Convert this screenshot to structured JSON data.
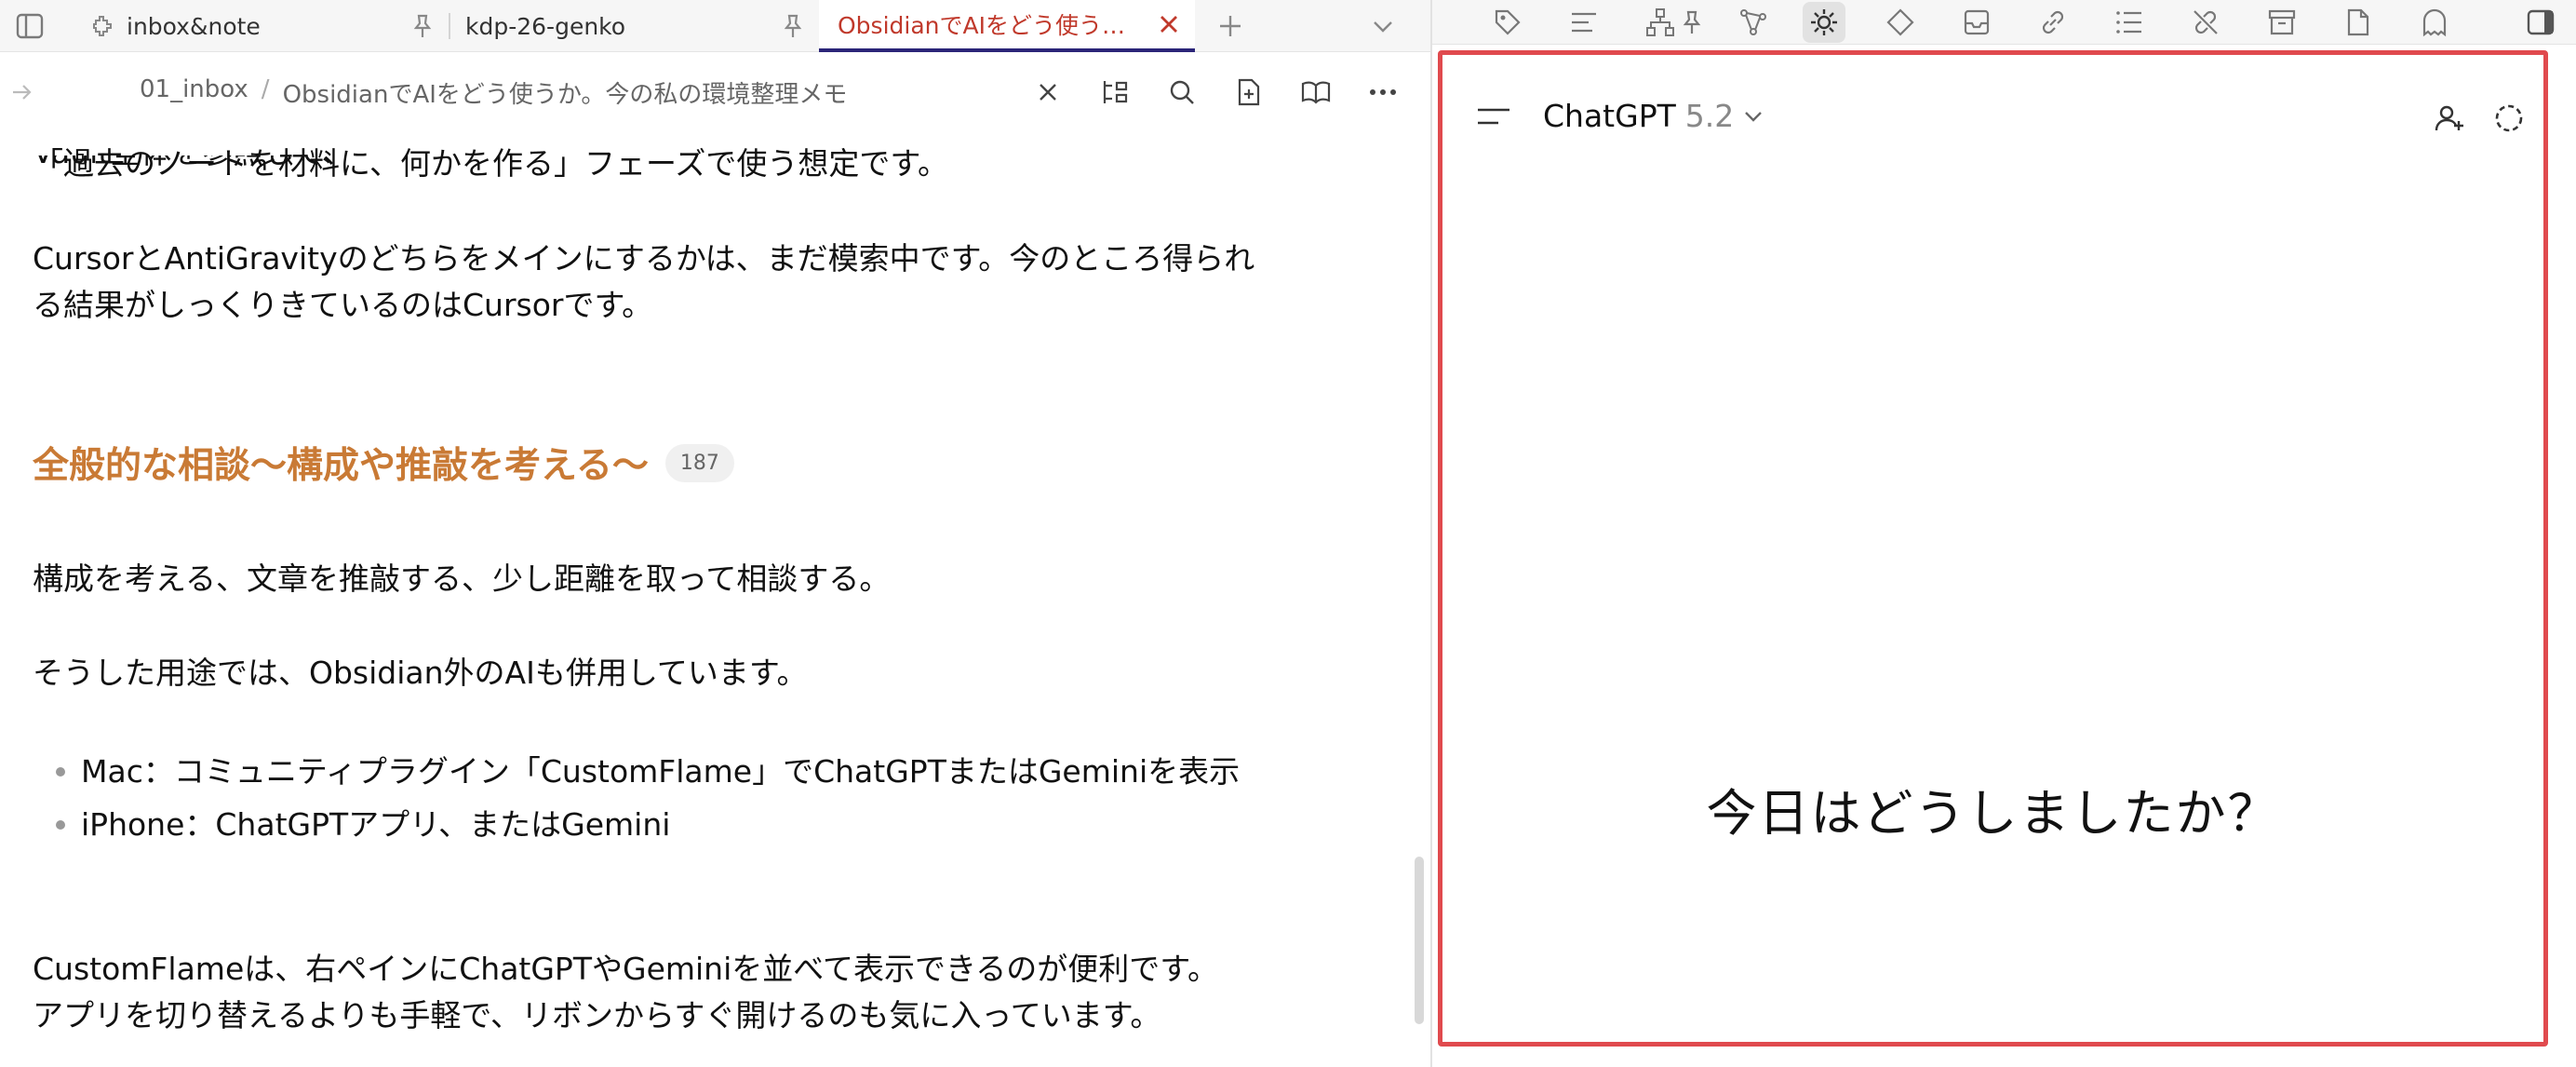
{
  "tabs": [
    {
      "label": "inbox&note",
      "icon": "plugin-icon",
      "pinned": true
    },
    {
      "label": "kdp-26-genko",
      "pinned": true
    },
    {
      "label": "ObsidianでAIをどう使う…",
      "active": true,
      "close_icon": "close-icon"
    }
  ],
  "tab_bar": {
    "sidebar_toggle_icon": "sidebar-left-icon",
    "new_tab_icon": "plus-icon",
    "tab_list_icon": "chevron-down-icon"
  },
  "view_header": {
    "back_icon": "arrow-right-icon",
    "breadcrumb": {
      "folder": "01_inbox",
      "separator": "/",
      "file": "ObsidianでAIをどう使うか。今の私の環境整理メモ"
    },
    "actions": [
      "close-icon",
      "outline-icon",
      "search-icon",
      "new-note-icon",
      "reading-view-icon",
      "more-options-icon"
    ]
  },
  "note": {
    "line_1": "「過去のノートを材料に、何かを作る」フェーズで使う想定です。",
    "line_2": "CursorとAntiGravityのどちらをメインにするかは、まだ模索中です。今のところ得られ",
    "line_3": "る結果がしっくりきているのはCursorです。",
    "heading": "全般的な相談〜構成や推敲を考える〜",
    "heading_badge": "187",
    "line_4": "構成を考える、文章を推敲する、少し距離を取って相談する。",
    "line_5": "そうした用途では、Obsidian外のAIも併用しています。",
    "bullets": [
      "Mac：コミュニティプラグイン「CustomFlame」でChatGPTまたはGeminiを表示",
      "iPhone：ChatGPTアプリ、またはGemini"
    ],
    "line_6": "CustomFlameは、右ペインにChatGPTやGeminiを並べて表示できるのが便利です。",
    "line_7": "アプリを切り替えるよりも手軽で、リボンからすぐ開けるのも気に入っています。"
  },
  "ribbon": {
    "icons": [
      "tag-icon",
      "align-left-icon",
      "hierarchy-icon",
      "pin-icon",
      "graph-icon",
      "openai-icon",
      "diamond-icon",
      "archive-box-icon",
      "link-icon",
      "list-icon",
      "unlink-icon",
      "archive-icon",
      "file-icon",
      "ghost-icon",
      "sidebar-right-icon"
    ],
    "active": "openai-icon"
  },
  "chat": {
    "menu_icon": "hamburger-icon",
    "title": "ChatGPT",
    "version": "5.2",
    "add_user_icon": "add-user-icon",
    "temp_chat_icon": "temporary-chat-icon",
    "greeting": "今日はどうしましたか？"
  },
  "colors": {
    "accent_active_tab": "#c0392b",
    "tab_underline": "#2b2578",
    "heading": "#c97a35",
    "frame_border": "#e04a4e"
  }
}
